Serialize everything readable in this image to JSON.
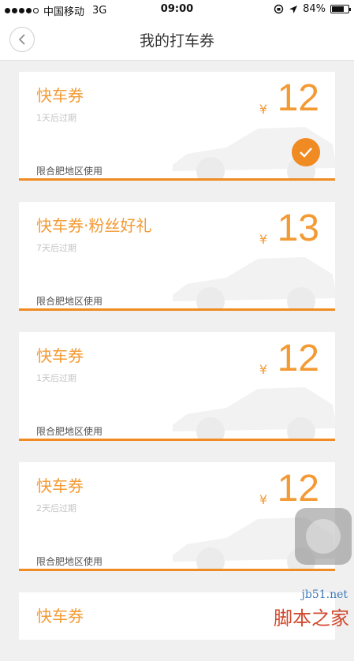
{
  "status_bar": {
    "carrier": "中国移动",
    "network": "3G",
    "time": "09:00",
    "battery": "84%",
    "battery_level": 0.84
  },
  "header": {
    "title": "我的打车券"
  },
  "coupons": [
    {
      "name": "快车券",
      "expiry": "1天后过期",
      "currency": "¥",
      "amount": "12",
      "region": "限合肥地区使用",
      "selected": true
    },
    {
      "name": "快车券·粉丝好礼",
      "expiry": "7天后过期",
      "currency": "¥",
      "amount": "13",
      "region": "限合肥地区使用",
      "selected": false
    },
    {
      "name": "快车券",
      "expiry": "1天后过期",
      "currency": "¥",
      "amount": "12",
      "region": "限合肥地区使用",
      "selected": false
    },
    {
      "name": "快车券",
      "expiry": "2天后过期",
      "currency": "¥",
      "amount": "12",
      "region": "限合肥地区使用",
      "selected": false
    },
    {
      "name": "快车券"
    }
  ],
  "watermark": {
    "url": "jb51.net",
    "text": "脚本之家"
  },
  "colors": {
    "accent": "#f08a22",
    "background": "#f0f0f0"
  }
}
